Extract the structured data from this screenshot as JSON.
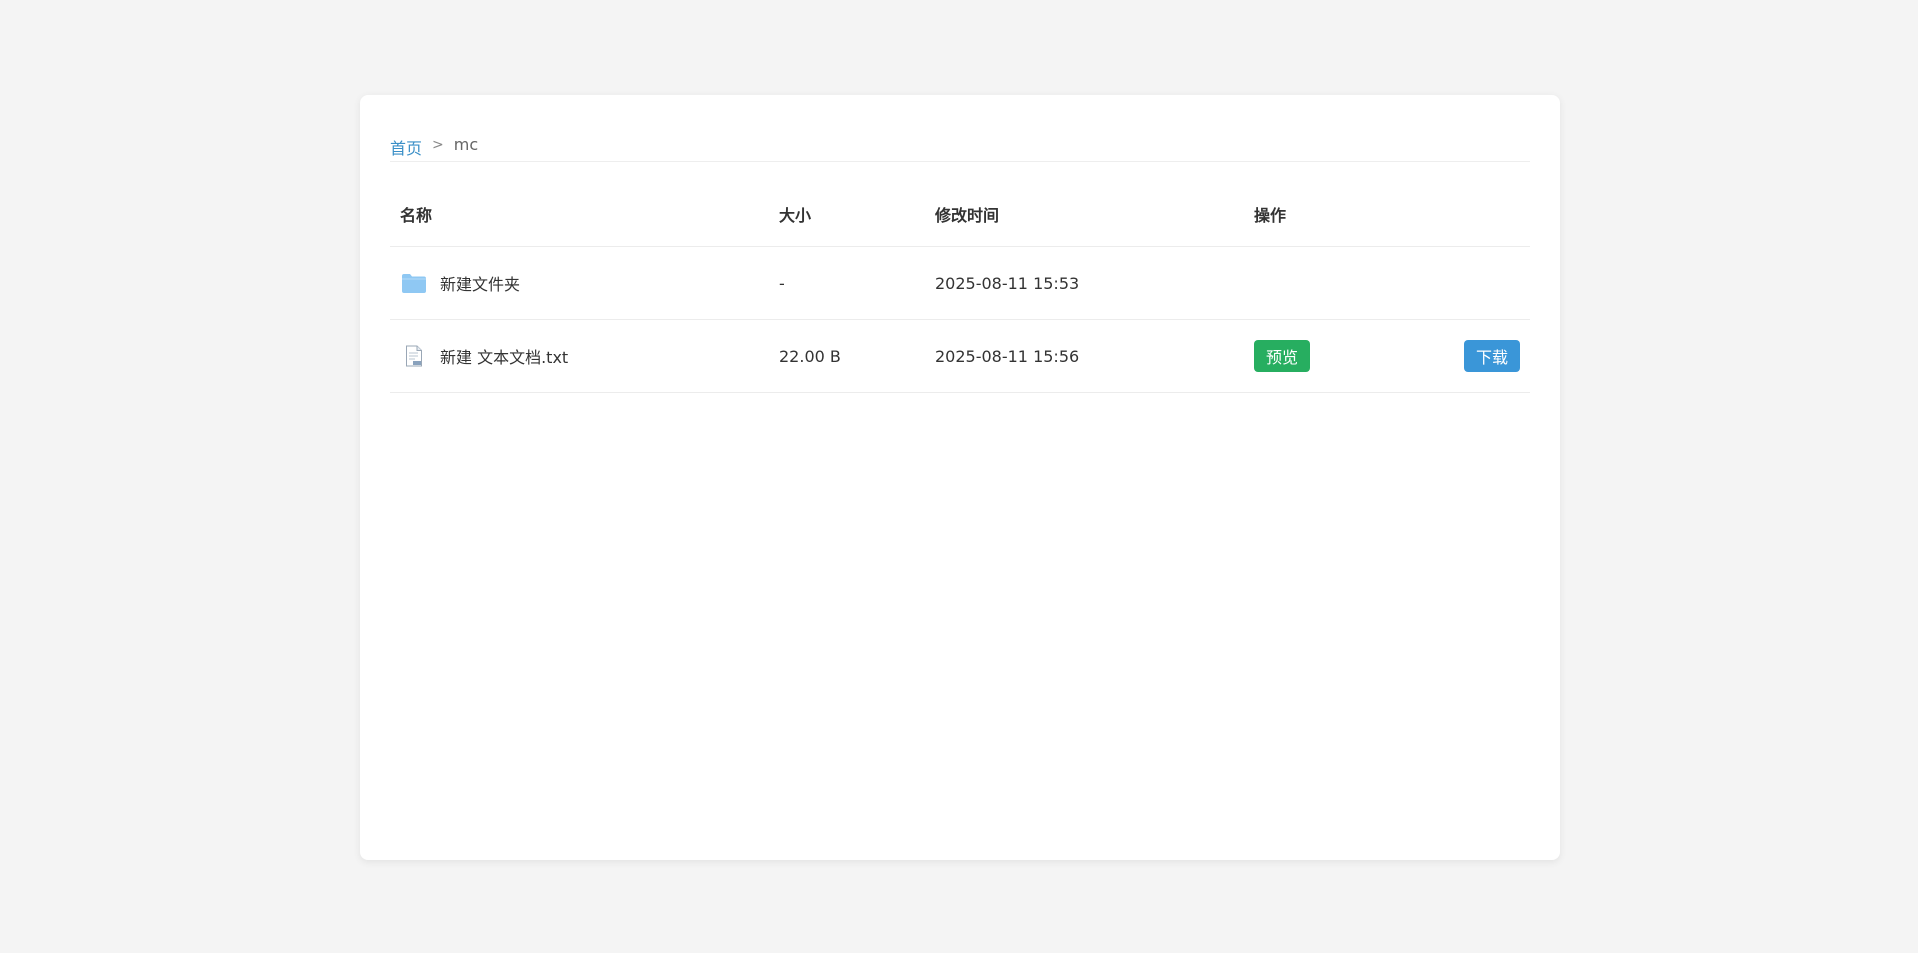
{
  "breadcrumb": {
    "home": "首页",
    "separator": ">",
    "current": "mc"
  },
  "table": {
    "columns": {
      "name": "名称",
      "size": "大小",
      "modified": "修改时间",
      "actions": "操作"
    },
    "rows": [
      {
        "type": "folder",
        "icon": "folder-icon",
        "name": "新建文件夹",
        "size": "-",
        "modified": "2025-08-11 15:53"
      },
      {
        "type": "file",
        "icon": "text-file-icon",
        "name": "新建 文本文档.txt",
        "size": "22.00 B",
        "modified": "2025-08-11 15:56",
        "preview_label": "预览",
        "download_label": "下载"
      }
    ]
  },
  "colors": {
    "link": "#3a8fc7",
    "preview_button": "#27ae60",
    "download_button": "#3a96d8",
    "folder_icon": "#8fc8f3",
    "background": "#f4f4f4"
  }
}
